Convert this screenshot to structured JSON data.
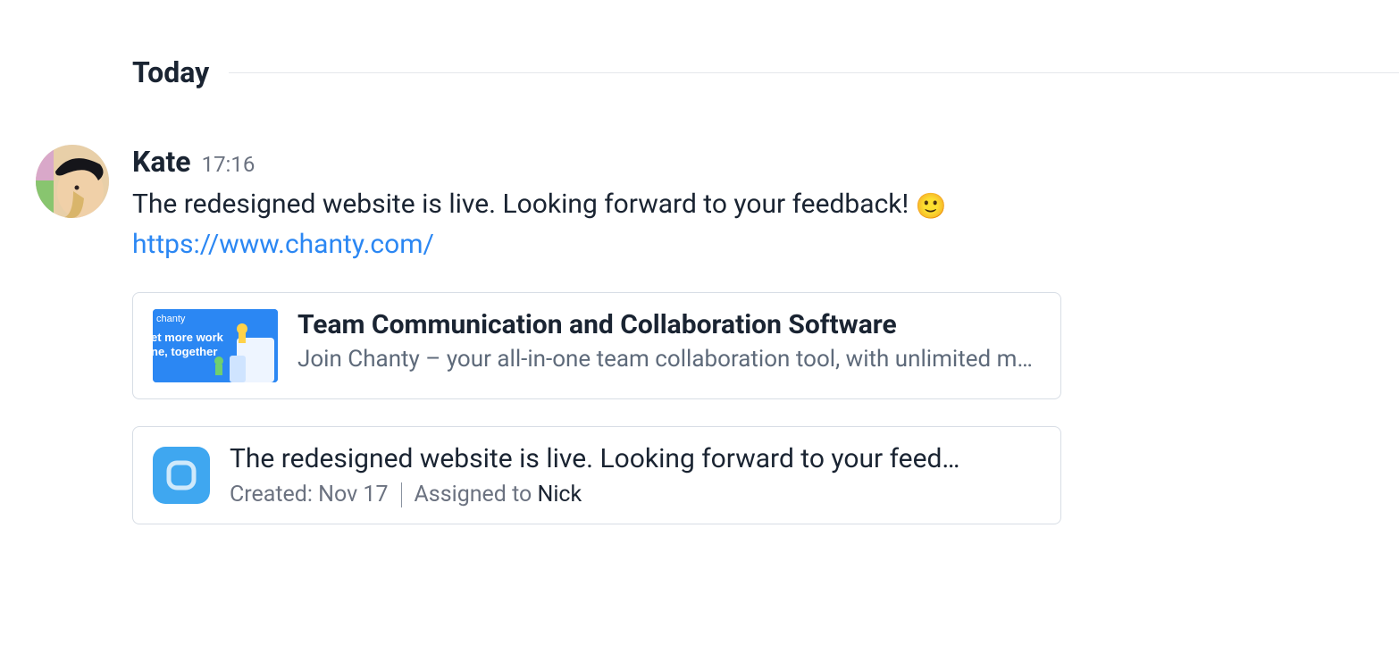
{
  "divider": {
    "label": "Today"
  },
  "message": {
    "author": "Kate",
    "time": "17:16",
    "text": "The redesigned website is live. Looking forward to your feedback! ",
    "emoji": "🙂",
    "link": "https://www.chanty.com/"
  },
  "link_preview": {
    "title": "Team Communication and Collaboration Software",
    "description": "Join Chanty – your all-in-one team collaboration tool, with unlimited me…",
    "thumb_label_1": "chanty",
    "thumb_label_2": "et more work",
    "thumb_label_3": "ne, together"
  },
  "task_card": {
    "title": "The redesigned website is live. Looking forward to your feed…",
    "created_label": "Created: ",
    "created_value": "Nov 17",
    "assigned_label": "Assigned to ",
    "assignee": "Nick"
  }
}
